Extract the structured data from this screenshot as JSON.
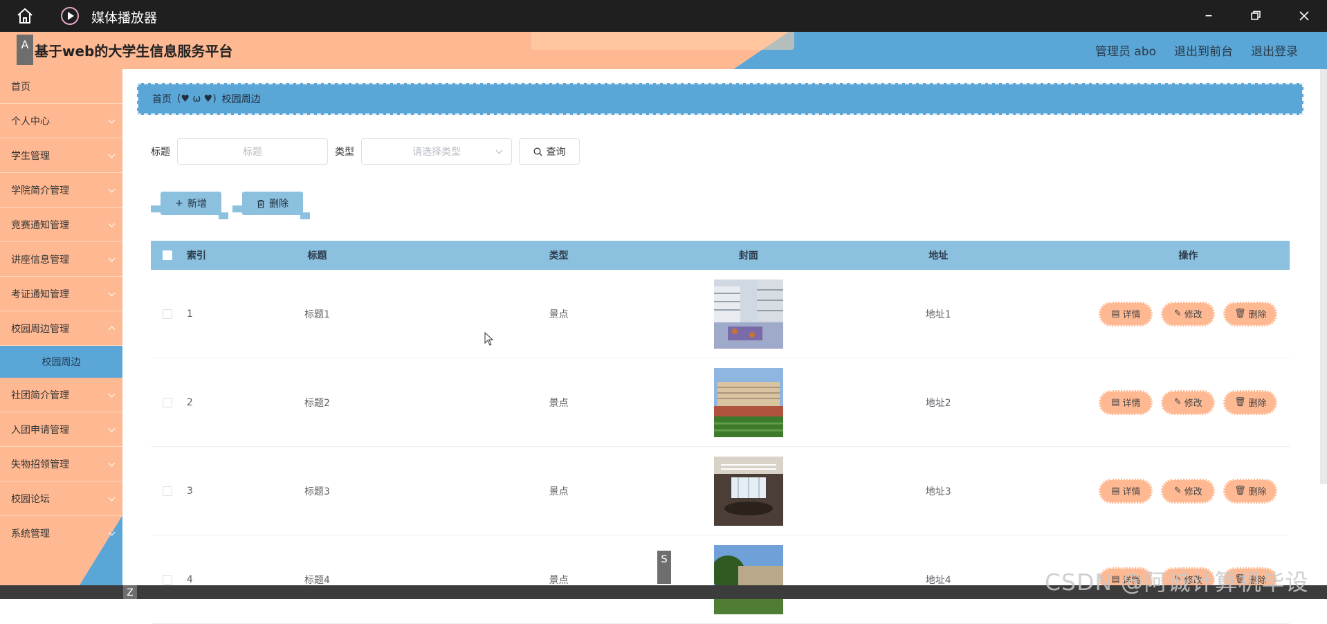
{
  "window": {
    "title": "媒体播放器"
  },
  "app": {
    "avatar_letter": "A",
    "title": "基于web的大学生信息服务平台",
    "header_links": [
      "管理员 abo",
      "退出到前台",
      "退出登录"
    ]
  },
  "sidebar": {
    "items": [
      "首页",
      "个人中心",
      "学生管理",
      "学院简介管理",
      "竞赛通知管理",
      "讲座信息管理",
      "考证通知管理",
      "校园周边管理"
    ],
    "sub_item": "校园周边",
    "items_after": [
      "社团简介管理",
      "入团申请管理",
      "失物招领管理",
      "校园论坛",
      "系统管理"
    ]
  },
  "breadcrumb": {
    "home": "首页",
    "separator": "(♥ ω ♥)",
    "current": "校园周边"
  },
  "search": {
    "title_label": "标题",
    "title_placeholder": "标题",
    "type_label": "类型",
    "type_placeholder": "请选择类型",
    "query_button": "查询"
  },
  "actions": {
    "add": "新增",
    "delete": "删除"
  },
  "table": {
    "headers": [
      "索引",
      "标题",
      "类型",
      "封面",
      "地址",
      "操作"
    ],
    "rows": [
      {
        "index": "1",
        "title": "标题1",
        "type": "景点",
        "address": "地址1"
      },
      {
        "index": "2",
        "title": "标题2",
        "type": "景点",
        "address": "地址2"
      },
      {
        "index": "3",
        "title": "标题3",
        "type": "景点",
        "address": "地址3"
      },
      {
        "index": "4",
        "title": "标题4",
        "type": "景点",
        "address": "地址4"
      }
    ],
    "row_actions": [
      "详情",
      "修改",
      "删除"
    ]
  },
  "overlay": {
    "s_badge": "S",
    "z_badge": "Z",
    "watermark": "CSDN @阿诚计算机毕设"
  },
  "colors": {
    "peach": "#ffb992",
    "blue": "#5aa6d6",
    "header_blue": "#8cc0df"
  }
}
